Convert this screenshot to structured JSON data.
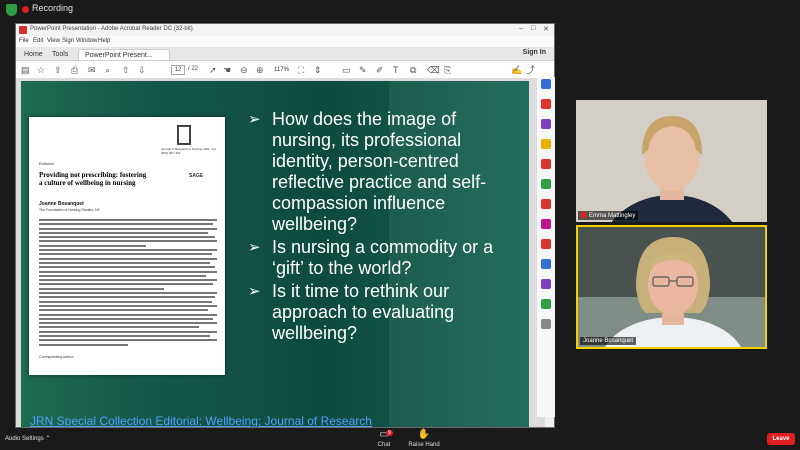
{
  "meeting": {
    "recording_label": "Recording",
    "audio_settings_label": "Audio Settings",
    "chat_label": "Chat",
    "chat_badge": "9",
    "raise_hand_label": "Raise Hand",
    "leave_label": "Leave"
  },
  "acrobat": {
    "window_title": "PowerPoint Presentation - Adobe Acrobat Reader DC (32-bit)",
    "menu": [
      "File",
      "Edit",
      "View",
      "Sign",
      "Window",
      "Help"
    ],
    "tabs": [
      "Home",
      "Tools",
      "PowerPoint Present..."
    ],
    "sign_in": "Sign In",
    "page_current": "12",
    "page_total": "/ 22",
    "zoom": "117%"
  },
  "slide": {
    "bullets": [
      "How does the image of nursing, its professional identity, person-centred reflective practice and self-compassion influence wellbeing?",
      "Is nursing a commodity or a ‘gift’ to the world?",
      "Is it time to rethink our approach to evaluating wellbeing?"
    ],
    "footer_link": "JRN Special Collection Editorial: Wellbeing: Journal of Research"
  },
  "paper": {
    "section": "Editorial",
    "title": "Providing not prescribing: fostering a culture of wellbeing in nursing",
    "author": "Joanne Bosanquet",
    "affiliation": "The Foundation of Nursing Studies, UK",
    "journal_info": "Journal of Research in Nursing 2021, Vol. 26(5) 387–391",
    "publisher": "SAGE",
    "correspondence_label": "Corresponding author:"
  },
  "participants": [
    {
      "name": "Emma Mattingley"
    },
    {
      "name": "Joanne Bosanquet"
    }
  ],
  "colors": {
    "slide_green": "#15584a",
    "accent_red": "#e02020",
    "active_speaker": "#f0d000",
    "link_blue": "#4ea1ff"
  }
}
